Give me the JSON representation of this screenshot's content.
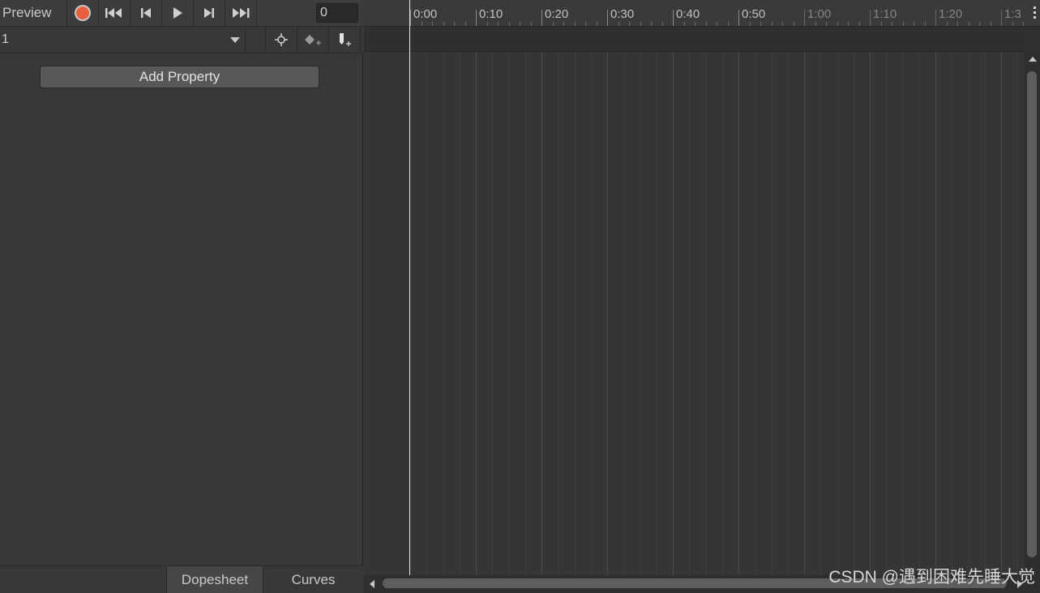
{
  "toolbar": {
    "preview_label": "Preview",
    "frame_value": "0",
    "record_color": "#e8603e",
    "icons": [
      "record-icon",
      "first-keyframe-icon",
      "prev-keyframe-icon",
      "play-icon",
      "next-keyframe-icon",
      "last-keyframe-icon"
    ]
  },
  "clip": {
    "selected": "1",
    "icons": [
      "filter-selection-icon",
      "add-keyframe-icon",
      "add-event-icon"
    ]
  },
  "properties": {
    "add_button_label": "Add Property"
  },
  "tabs": [
    {
      "label": "Dopesheet",
      "active": true
    },
    {
      "label": "Curves",
      "active": false
    }
  ],
  "timeline": {
    "ticks": [
      "0:00",
      "0:10",
      "0:20",
      "0:30",
      "0:40",
      "0:50",
      "1:00",
      "1:10",
      "1:20",
      "1:3"
    ],
    "clip_end_label": "1:00"
  },
  "watermark": "CSDN @遇到困难先睡大觉"
}
